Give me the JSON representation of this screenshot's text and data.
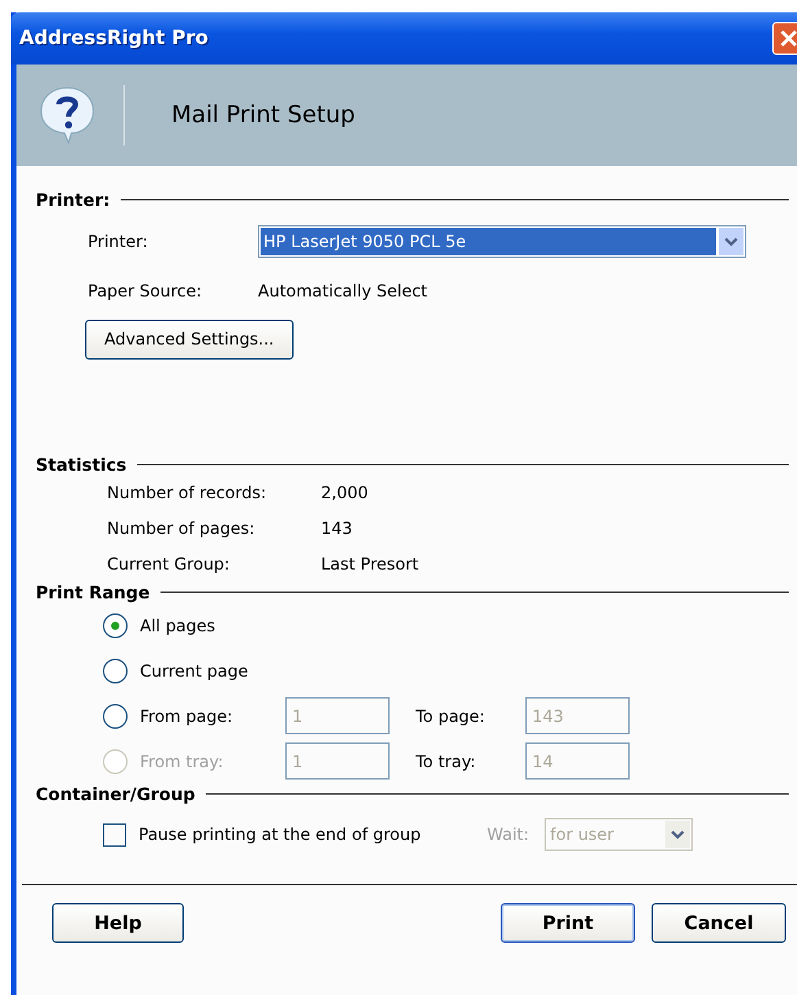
{
  "window": {
    "title": "AddressRight Pro"
  },
  "header": {
    "title": "Mail Print Setup"
  },
  "printer": {
    "heading": "Printer:",
    "printer_label": "Printer:",
    "printer_value": "HP LaserJet 9050 PCL 5e",
    "paper_source_label": "Paper Source:",
    "paper_source_value": "Automatically Select",
    "advanced_button": "Advanced Settings..."
  },
  "statistics": {
    "heading": "Statistics",
    "rows": [
      {
        "label": "Number of records:",
        "value": "2,000"
      },
      {
        "label": "Number of pages:",
        "value": "143"
      },
      {
        "label": "Current Group:",
        "value": "Last Presort"
      }
    ]
  },
  "print_range": {
    "heading": "Print Range",
    "options": [
      {
        "kind": "plain",
        "label": "All pages",
        "selected": true,
        "disabled": false
      },
      {
        "kind": "plain",
        "label": "Current page",
        "selected": false,
        "disabled": false
      },
      {
        "kind": "range",
        "label": "From page:",
        "selected": false,
        "disabled": false,
        "from": "1",
        "to_label": "To page:",
        "to": "143"
      },
      {
        "kind": "range",
        "label": "From tray:",
        "selected": false,
        "disabled": true,
        "from": "1",
        "to_label": "To tray:",
        "to": "14"
      }
    ]
  },
  "container_group": {
    "heading": "Container/Group",
    "pause_label": "Pause printing at the end of group",
    "checked": false,
    "wait_label": "Wait:",
    "wait_value": "for user",
    "wait_disabled": true
  },
  "buttons": [
    {
      "label": "Help",
      "default": false
    },
    {
      "label": "Print",
      "default": true
    },
    {
      "label": "Cancel",
      "default": false
    }
  ]
}
